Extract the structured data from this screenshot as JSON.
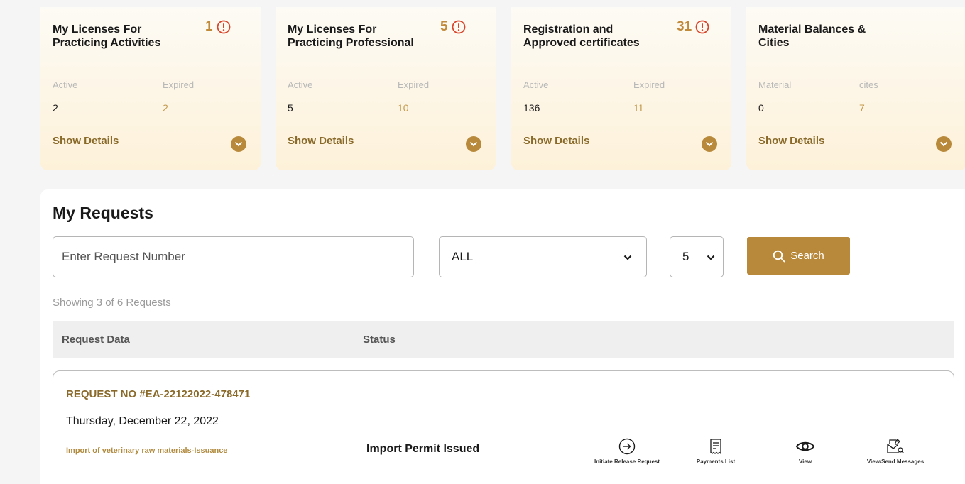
{
  "cards": [
    {
      "title": "My Licenses For Practicing Activities",
      "count": "1",
      "label1": "Active",
      "label2": "Expired",
      "value1": "2",
      "value2": "2",
      "link": "Show Details"
    },
    {
      "title": "My Licenses For Practicing Professional",
      "count": "5",
      "label1": "Active",
      "label2": "Expired",
      "value1": "5",
      "value2": "10",
      "link": "Show Details"
    },
    {
      "title": "Registration and Approved certificates",
      "count": "31",
      "label1": "Active",
      "label2": "Expired",
      "value1": "136",
      "value2": "11",
      "link": "Show Details"
    },
    {
      "title": "Material Balances & Cities",
      "label1": "Material",
      "label2": "cites",
      "value1": "0",
      "value2": "7",
      "link": "Show Details"
    }
  ],
  "requests": {
    "title": "My Requests",
    "search_placeholder": "Enter Request Number",
    "status_filter": "ALL",
    "page_size": "5",
    "search_label": "Search",
    "showing_text": "Showing 3 of 6 Requests",
    "columns": [
      "Request Data",
      "Status"
    ],
    "items": [
      {
        "number": "REQUEST NO #EA-22122022-478471",
        "date": "Thursday, December 22, 2022",
        "service": "Import of veterinary raw materials-Issuance",
        "status": "Import Permit Issued",
        "actions": [
          {
            "label": "Initiate Release Request",
            "icon": "arrow-circle-right-icon"
          },
          {
            "label": "Payments List",
            "icon": "receipt-icon"
          },
          {
            "label": "View",
            "icon": "eye-icon"
          },
          {
            "label": "View/Send Messages",
            "icon": "envelope-search-icon"
          }
        ]
      }
    ]
  },
  "colors": {
    "accent": "#b8893a",
    "alert": "#d9452b",
    "card_bg": "#fdf1d9"
  }
}
